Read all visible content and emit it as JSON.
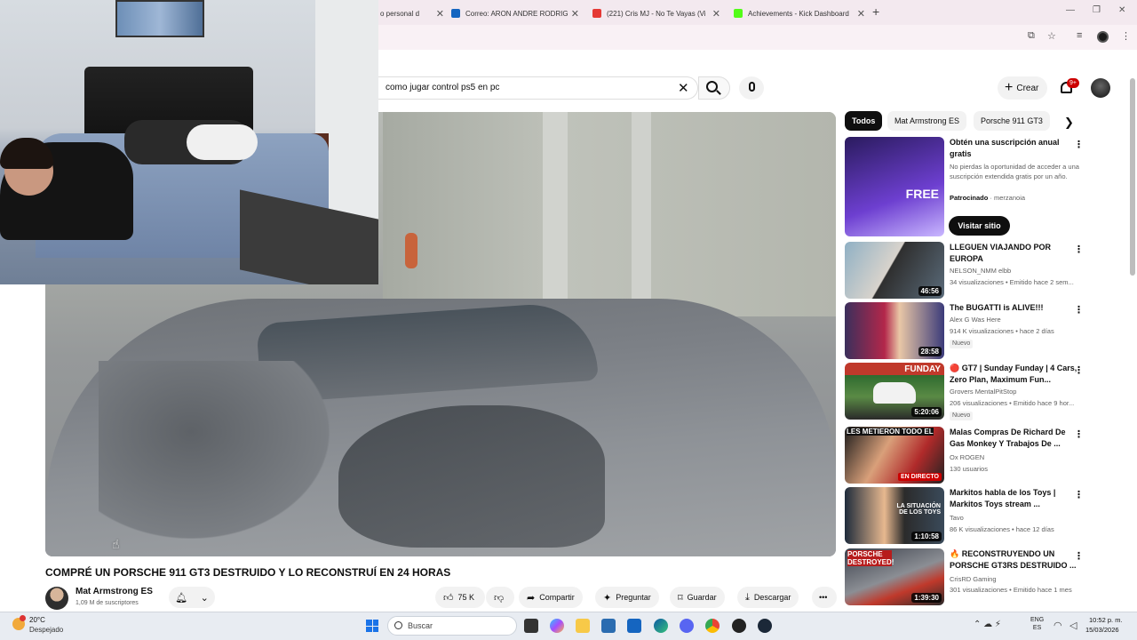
{
  "browser": {
    "tabs": [
      {
        "label": "o personal d",
        "color": "#ffffff"
      },
      {
        "label": "Correo: ARON ANDRE RODRIG",
        "color": "#1565c0"
      },
      {
        "label": "(221) Cris MJ - No Te Vayas (Vi",
        "color": "#e53935"
      },
      {
        "label": "Achievements - Kick Dashboard",
        "color": "#53fc18"
      }
    ],
    "new_tab": "+"
  },
  "youtube": {
    "search": {
      "value": "como jugar control ps5 en pc"
    },
    "create_label": "Crear",
    "notif_count": "9+"
  },
  "video": {
    "title": "COMPRÉ UN PORSCHE 911 GT3 DESTRUIDO Y LO RECONSTRUÍ EN 24 HORAS",
    "channel": "Mat Armstrong ES",
    "subscribers": "1,09 M de suscriptores",
    "likes": "75 K",
    "actions": {
      "share": "Compartir",
      "ask": "Preguntar",
      "save": "Guardar",
      "download": "Descargar"
    }
  },
  "sidebar": {
    "chips": [
      "Todos",
      "Mat Armstrong ES",
      "Porsche 911 GT3"
    ],
    "ad": {
      "title": "Obtén una suscripción anual gratis",
      "desc": "No pierdas la oportunidad de acceder a una suscripción extendida gratis por un año.",
      "sponsored": "Patrocinado",
      "advertiser": "merzanoia",
      "cta": "Visitar sitio",
      "thumb_text": "FREE"
    },
    "recs": [
      {
        "title": "LLEGUEN VIAJANDO POR EUROPA",
        "channel": "NELSON_NMM elbb",
        "meta": "34 visualizaciones • Emitido hace 2 sem...",
        "duration": "46:56",
        "new": ""
      },
      {
        "title": "The BUGATTI is ALIVE!!!",
        "channel": "Alex G Was Here",
        "meta": "914 K visualizaciones • hace 2 días",
        "duration": "28:58",
        "new": "Nuevo"
      },
      {
        "title": "🔴 GT7 | Sunday Funday | 4 Cars, Zero Plan, Maximum Fun...",
        "channel": "Grovers MentalPitStop",
        "meta": "206 visualizaciones • Emitido hace 9 hor...",
        "duration": "5:20:06",
        "new": "Nuevo",
        "thumb_text": "FUNDAY"
      },
      {
        "title": "Malas Compras De Richard De Gas Monkey Y Trabajos De ...",
        "channel": "Ox ROGEN",
        "meta": "130 usuarios",
        "duration": "",
        "new": "",
        "thumb_text": "LES METIERON TODO EL",
        "live": "EN DIRECTO"
      },
      {
        "title": "Markitos habla de los Toys | Markitos Toys stream ...",
        "channel": "Tavo",
        "meta": "86 K visualizaciones • hace 12 días",
        "duration": "1:10:58",
        "new": "",
        "thumb_text": "LA SITUACIÓN DE LOS TOYS"
      },
      {
        "title": "🔥 RECONSTRUYENDO UN PORSCHE GT3RS DESTRUIDO ...",
        "channel": "CrisRD Gaming",
        "meta": "301 visualizaciones • Emitido hace 1 mes",
        "duration": "1:39:30",
        "new": "",
        "thumb_text": "PORSCHE DESTROYED!"
      }
    ]
  },
  "taskbar": {
    "weather_temp": "20°C",
    "weather_desc": "Despejado",
    "search_placeholder": "Buscar",
    "lang_top": "ENG",
    "lang_bottom": "ES",
    "time": "10:52 p. m.",
    "date": "15/03/2026"
  }
}
